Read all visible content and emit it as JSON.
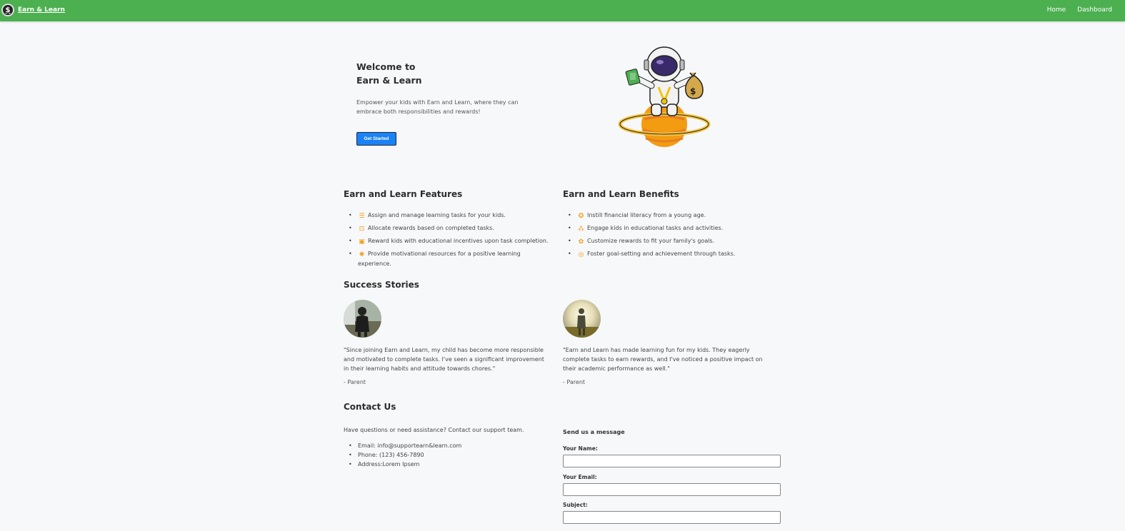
{
  "nav": {
    "brand": "Earn & Learn",
    "logo_glyph": "$",
    "links": [
      "Home",
      "Dashboard"
    ]
  },
  "hero": {
    "title_line1": "Welcome to",
    "title_line2": "Earn & Learn",
    "text": "Empower your kids with Earn and Learn, where they can embrace both responsibilities and rewards!",
    "button": "Get Started"
  },
  "features": {
    "title": "Earn and Learn Features",
    "items": [
      {
        "icon": "task-list-icon",
        "text": "Assign and manage learning tasks for your kids."
      },
      {
        "icon": "reward-icon",
        "text": "Allocate rewards based on completed tasks."
      },
      {
        "icon": "gift-icon",
        "text": "Reward kids with educational incentives upon task completion."
      },
      {
        "icon": "badge-icon",
        "text": "Provide motivational resources for a positive learning experience."
      }
    ]
  },
  "benefits": {
    "title": "Earn and Learn Benefits",
    "items": [
      {
        "icon": "piggy-bank-icon",
        "text": "Instill financial literacy from a young age."
      },
      {
        "icon": "people-icon",
        "text": "Engage kids in educational tasks and activities."
      },
      {
        "icon": "settings-icon",
        "text": "Customize rewards to fit your family's goals."
      },
      {
        "icon": "target-icon",
        "text": "Foster goal-setting and achievement through tasks."
      }
    ]
  },
  "stories": {
    "title": "Success Stories",
    "items": [
      {
        "quote": "\"Since joining Earn and Learn, my child has become more responsible and motivated to complete tasks. I've seen a significant improvement in their learning habits and attitude towards chores.\"",
        "author": "- Parent"
      },
      {
        "quote": "\"Earn and Learn has made learning fun for my kids. They eagerly complete tasks to earn rewards, and I've noticed a positive impact on their academic performance as well.\"",
        "author": "- Parent"
      }
    ]
  },
  "contact": {
    "title": "Contact Us",
    "text": "Have questions or need assistance? Contact our support team.",
    "items": [
      "Email: info@supportearn&learn.com",
      "Phone: (123) 456-7890",
      "Address:Lorem Ipsem"
    ],
    "form": {
      "title": "Send us a message",
      "name_label": "Your Name:",
      "email_label": "Your Email:",
      "subject_label": "Subject:"
    }
  },
  "colors": {
    "navbar": "#4caf50",
    "primary_button": "#1a82f7",
    "icon_accent": "#f39c12"
  }
}
